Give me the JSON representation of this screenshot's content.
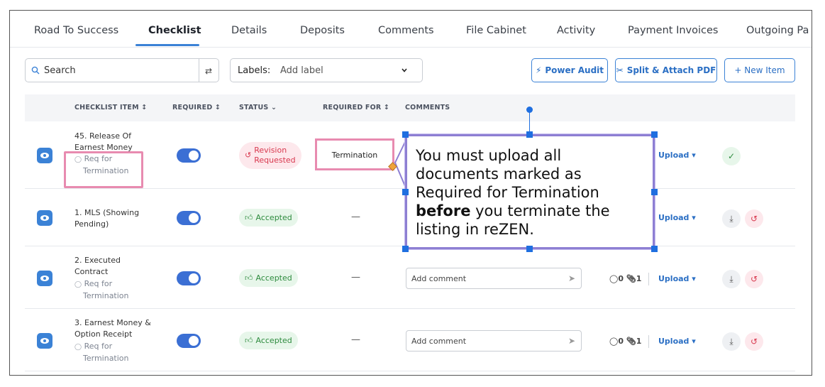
{
  "tabs": [
    {
      "label": "Road To Success"
    },
    {
      "label": "Checklist"
    },
    {
      "label": "Details"
    },
    {
      "label": "Deposits"
    },
    {
      "label": "Comments"
    },
    {
      "label": "File Cabinet"
    },
    {
      "label": "Activity"
    },
    {
      "label": "Payment Invoices"
    },
    {
      "label": "Outgoing Pa"
    }
  ],
  "toolbar": {
    "search_placeholder": "Search",
    "labels_label": "Labels:",
    "labels_value": "Add label",
    "power_audit": "Power Audit",
    "split_attach": "Split & Attach PDF",
    "new_item": "+ New Item"
  },
  "table": {
    "headers": {
      "item": "CHECKLIST ITEM ↕",
      "required": "REQUIRED ↕",
      "status": "STATUS ⌄",
      "required_for": "REQUIRED FOR ↕",
      "comments": "COMMENTS"
    },
    "rows": [
      {
        "item_line1": "45. Release Of",
        "item_line2": "Earnest Money",
        "req_line1": "Req for",
        "req_line2": "Termination",
        "status_line1": "Revision",
        "status_line2": "Requested",
        "required_for": "Termination",
        "upload": "Upload ▾"
      },
      {
        "item_line1": "1. MLS (Showing",
        "item_line2": "Pending)",
        "status": "Accepted",
        "required_for": "—",
        "upload": "Upload ▾"
      },
      {
        "item_line1": "2. Executed",
        "item_line2": "Contract",
        "req_line1": "Req for",
        "req_line2": "Termination",
        "status": "Accepted",
        "required_for": "—",
        "comment_placeholder": "Add comment",
        "comments_count": "0",
        "attach_count": "1",
        "upload": "Upload ▾"
      },
      {
        "item_line1": "3. Earnest Money &",
        "item_line2": "Option Receipt",
        "req_line1": "Req for",
        "req_line2": "Termination",
        "status": "Accepted",
        "required_for": "—",
        "comment_placeholder": "Add comment",
        "comments_count": "0",
        "attach_count": "1",
        "upload": "Upload ▾"
      }
    ]
  },
  "callout": {
    "line1": "You must upload all",
    "line2": "documents marked as",
    "line3": "Required for Termination",
    "line4_bold": "before",
    "line4_rest": " you terminate the",
    "line5": "listing in reZEN."
  },
  "colors": {
    "accent": "#3b82d6",
    "accepted": "#2e8b3e",
    "revision": "#d8394f",
    "highlight": "#e88bb0",
    "callout_border": "#8e7fd3",
    "handle": "#1f6fe0"
  }
}
